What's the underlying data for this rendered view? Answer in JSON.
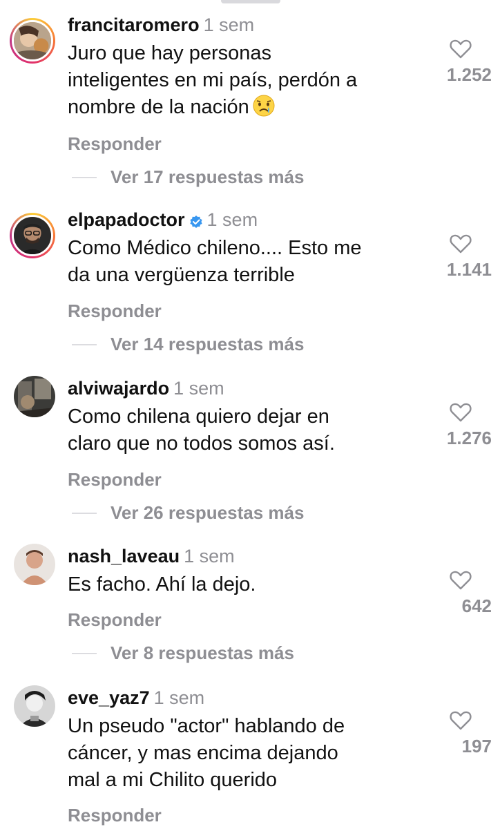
{
  "comments": [
    {
      "username": "francitaromero",
      "time": "1 sem",
      "verified": false,
      "text": "Juro que hay personas\ninteligentes en mi país, perdón a\nnombre de la nación",
      "emoji": "crying-face",
      "likes": "1.252",
      "reply_label": "Responder",
      "more_replies": "Ver 17 respuestas más"
    },
    {
      "username": "elpapadoctor",
      "time": "1 sem",
      "verified": true,
      "text": "Como Médico chileno.... Esto me\nda una vergüenza terrible",
      "likes": "1.141",
      "reply_label": "Responder",
      "more_replies": "Ver 14 respuestas más"
    },
    {
      "username": "alviwajardo",
      "time": "1 sem",
      "verified": false,
      "text": "Como chilena quiero dejar en\nclaro que no todos somos así.",
      "likes": "1.276",
      "reply_label": "Responder",
      "more_replies": "Ver 26 respuestas más"
    },
    {
      "username": "nash_laveau",
      "time": "1 sem",
      "verified": false,
      "text": "Es facho. Ahí la dejo.",
      "likes": "642",
      "reply_label": "Responder",
      "more_replies": "Ver 8 respuestas más"
    },
    {
      "username": "eve_yaz7",
      "time": "1 sem",
      "verified": false,
      "text": "Un pseudo \"actor\" hablando de\ncáncer, y mas encima dejando\nmal a mi Chilito querido",
      "likes": "197",
      "reply_label": "Responder"
    }
  ],
  "colors": {
    "text": "#111111",
    "muted": "#8e8e93",
    "verified": "#3897f0",
    "story_ring": [
      "#fccf3a",
      "#f77737",
      "#e1306c",
      "#c13584"
    ]
  },
  "icons": {
    "like": "heart-outline-icon",
    "verified": "verified-badge-icon"
  }
}
